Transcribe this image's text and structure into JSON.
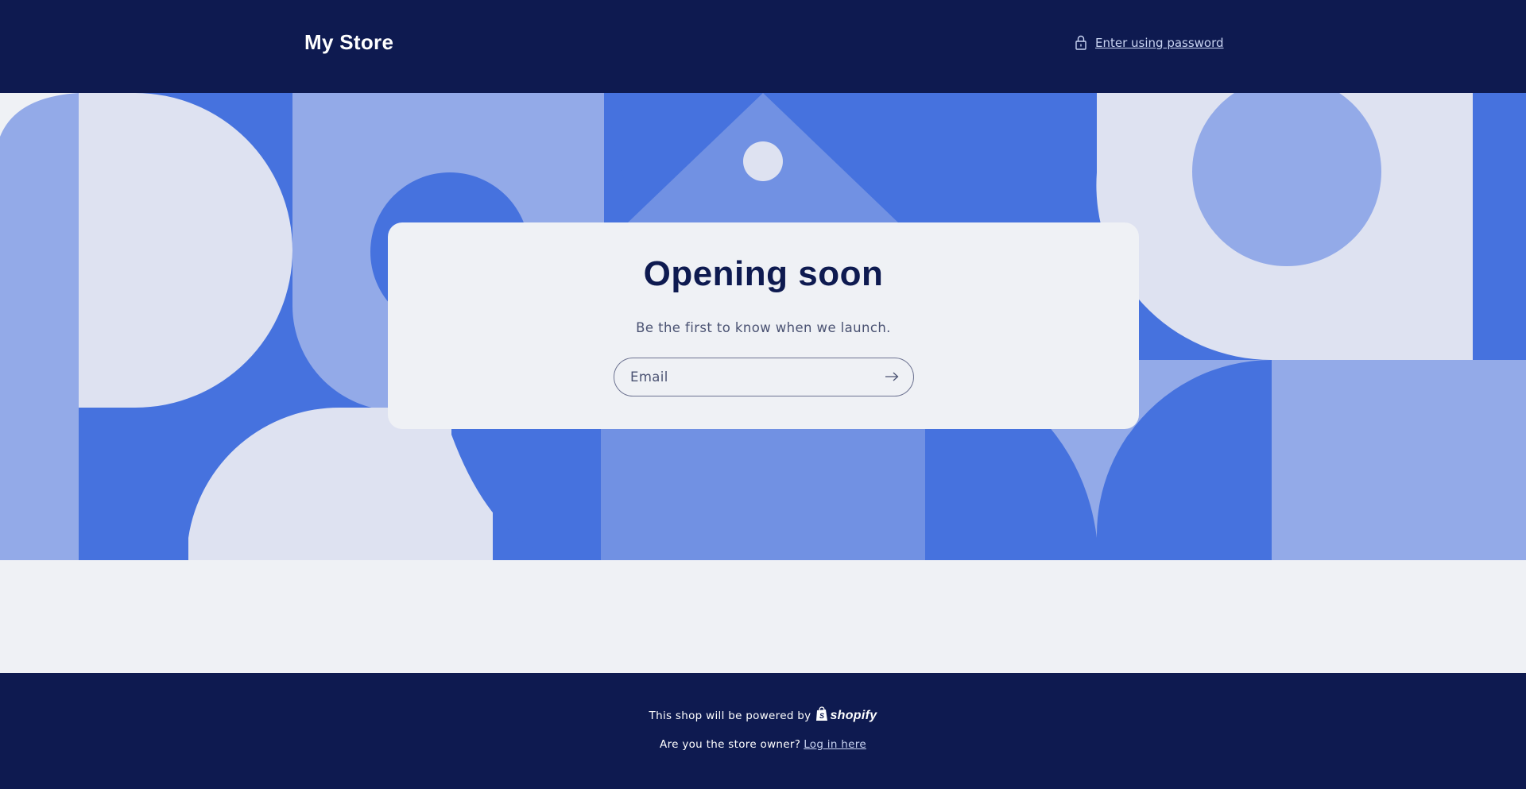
{
  "header": {
    "store_name": "My Store",
    "password_link": "Enter using password",
    "lock_icon": "lock-icon"
  },
  "card": {
    "title": "Opening soon",
    "subtitle": "Be the first to know when we launch.",
    "email_placeholder": "Email",
    "email_value": "",
    "submit_icon": "arrow-right-icon"
  },
  "footer": {
    "powered_text": "This shop will be powered by",
    "shopify_logo_text": "shopify",
    "owner_question": "Are you the store owner?",
    "login_link": "Log in here"
  },
  "colors": {
    "navy": "#0e1a50",
    "background": "#eff1f5",
    "blue_dark": "#4672de",
    "blue_mid": "#7191e3",
    "blue_light": "#93aae8",
    "pale": "#dee2f1",
    "link": "#c9d4f2"
  }
}
